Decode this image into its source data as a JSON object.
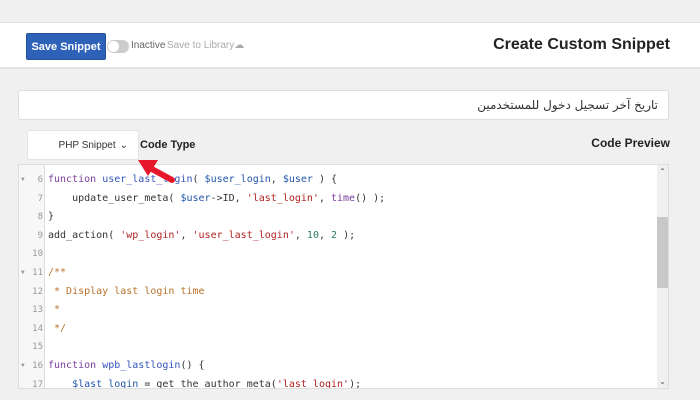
{
  "header": {
    "save_label": "Save Snippet",
    "status_label": "Inactive",
    "library_label": "Save to Library",
    "title": "Create Custom Snippet"
  },
  "snippet": {
    "name_value": "تاريخ آخر تسجيل دخول للمستخدمين"
  },
  "code_type": {
    "selected": "PHP Snippet",
    "label": "Code Type"
  },
  "preview": {
    "label": "Code Preview"
  },
  "code_lines": [
    {
      "n": "6",
      "fold": true,
      "tokens": [
        [
          "kw",
          "function "
        ],
        [
          "fn",
          "user_last_login"
        ],
        [
          "plain",
          "( "
        ],
        [
          "var",
          "$user_login"
        ],
        [
          "plain",
          ", "
        ],
        [
          "var",
          "$user"
        ],
        [
          "plain",
          " ) {"
        ]
      ]
    },
    {
      "n": "7",
      "fold": false,
      "tokens": [
        [
          "plain",
          "    update_user_meta( "
        ],
        [
          "var",
          "$user"
        ],
        [
          "plain",
          "->ID, "
        ],
        [
          "str",
          "'last_login'"
        ],
        [
          "plain",
          ", "
        ],
        [
          "kw",
          "time"
        ],
        [
          "plain",
          "() );"
        ]
      ]
    },
    {
      "n": "8",
      "fold": false,
      "tokens": [
        [
          "plain",
          "}"
        ]
      ]
    },
    {
      "n": "9",
      "fold": false,
      "tokens": [
        [
          "plain",
          "add_action( "
        ],
        [
          "str",
          "'wp_login'"
        ],
        [
          "plain",
          ", "
        ],
        [
          "str",
          "'user_last_login'"
        ],
        [
          "plain",
          ", "
        ],
        [
          "num",
          "10"
        ],
        [
          "plain",
          ", "
        ],
        [
          "num",
          "2"
        ],
        [
          "plain",
          " );"
        ]
      ]
    },
    {
      "n": "10",
      "fold": false,
      "tokens": []
    },
    {
      "n": "11",
      "fold": true,
      "tokens": [
        [
          "com",
          "/**"
        ]
      ]
    },
    {
      "n": "12",
      "fold": false,
      "tokens": [
        [
          "com",
          " * Display last login time"
        ]
      ]
    },
    {
      "n": "13",
      "fold": false,
      "tokens": [
        [
          "com",
          " *"
        ]
      ]
    },
    {
      "n": "14",
      "fold": false,
      "tokens": [
        [
          "com",
          " */"
        ]
      ]
    },
    {
      "n": "15",
      "fold": false,
      "tokens": []
    },
    {
      "n": "16",
      "fold": true,
      "tokens": [
        [
          "kw",
          "function "
        ],
        [
          "fn",
          "wpb_lastlogin"
        ],
        [
          "plain",
          "() {"
        ]
      ]
    },
    {
      "n": "17",
      "fold": false,
      "tokens": [
        [
          "plain",
          "    "
        ],
        [
          "var",
          "$last_login"
        ],
        [
          "plain",
          " = get_the_author_meta("
        ],
        [
          "str",
          "'last_login'"
        ],
        [
          "plain",
          ");"
        ]
      ]
    }
  ],
  "scrollbar": {
    "position_fraction": 0.24
  },
  "colors": {
    "primary": "#2e62b8",
    "annotation_arrow": "#e8182c"
  },
  "icons": {
    "library": "cloud-icon",
    "dropdown": "chevron-down-icon",
    "annotation": "red-arrow"
  }
}
